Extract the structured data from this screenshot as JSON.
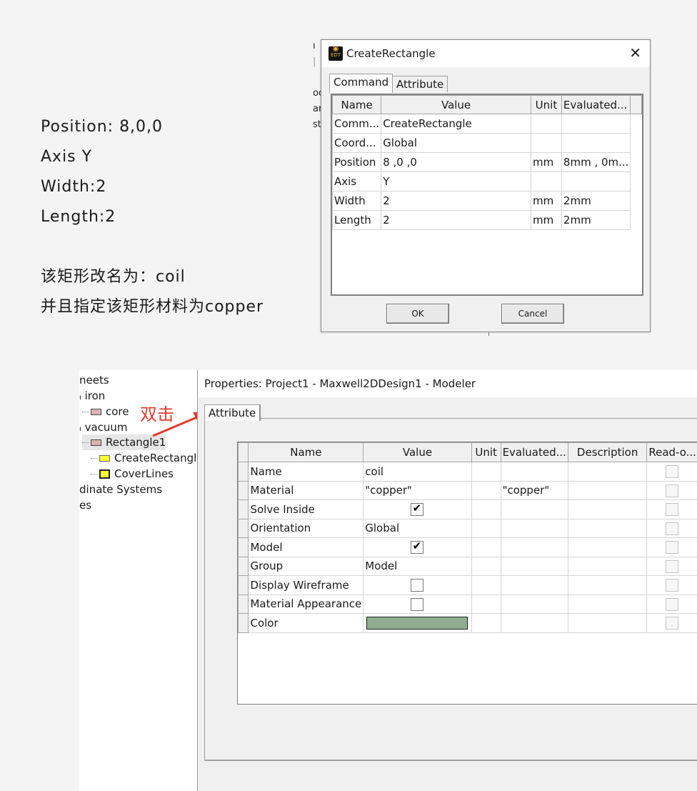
{
  "notes": {
    "lines": [
      "Position: 8,0,0",
      "Axis Y",
      "Width:2",
      "Length:2"
    ],
    "rename_line": "该矩形改名为：coil",
    "material_line": "并且指定该矩形材料为copper"
  },
  "background_window": {
    "fragments": [
      "ı",
      "|",
      "oc",
      "ar",
      "st"
    ]
  },
  "create_dialog": {
    "title": "CreateRectangle",
    "icon_text": "EDT",
    "tabs": [
      "Command",
      "Attribute"
    ],
    "columns": [
      "Name",
      "Value",
      "Unit",
      "Evaluated..."
    ],
    "rows": [
      [
        "Comm...",
        "CreateRectangle",
        "",
        ""
      ],
      [
        "Coord...",
        "Global",
        "",
        ""
      ],
      [
        "Position",
        "8 ,0 ,0",
        "mm",
        "8mm , 0m..."
      ],
      [
        "Axis",
        "Y",
        "",
        ""
      ],
      [
        "Width",
        "2",
        "mm",
        "2mm"
      ],
      [
        "Length",
        "2",
        "mm",
        "2mm"
      ]
    ],
    "ok_label": "OK",
    "cancel_label": "Cancel"
  },
  "tree": {
    "items": [
      "neets",
      "iron",
      "core",
      "vacuum",
      "Rectangle1",
      "CreateRectangle",
      "CoverLines",
      "dinate Systems",
      "es"
    ]
  },
  "annotation": {
    "text": "双击",
    "color": "#e43a2f"
  },
  "properties": {
    "title": "Properties: Project1 - Maxwell2DDesign1 - Modeler",
    "tab": "Attribute",
    "columns": [
      "Name",
      "Value",
      "Unit",
      "Evaluated...",
      "Description",
      "Read-o..."
    ],
    "rows": [
      {
        "name": "Name",
        "value": "coil",
        "unit": "",
        "evaluated": "",
        "kind": "text"
      },
      {
        "name": "Material",
        "value": "\"copper\"",
        "unit": "",
        "evaluated": "\"copper\"",
        "kind": "text"
      },
      {
        "name": "Solve Inside",
        "checked": true,
        "kind": "check"
      },
      {
        "name": "Orientation",
        "value": "Global",
        "unit": "",
        "evaluated": "",
        "kind": "text"
      },
      {
        "name": "Model",
        "checked": true,
        "kind": "check"
      },
      {
        "name": "Group",
        "value": "Model",
        "unit": "",
        "evaluated": "",
        "kind": "text"
      },
      {
        "name": "Display Wireframe",
        "checked": false,
        "kind": "check"
      },
      {
        "name": "Material Appearance",
        "checked": false,
        "kind": "check"
      },
      {
        "name": "Color",
        "color": "#8fae8f",
        "kind": "color"
      }
    ]
  }
}
